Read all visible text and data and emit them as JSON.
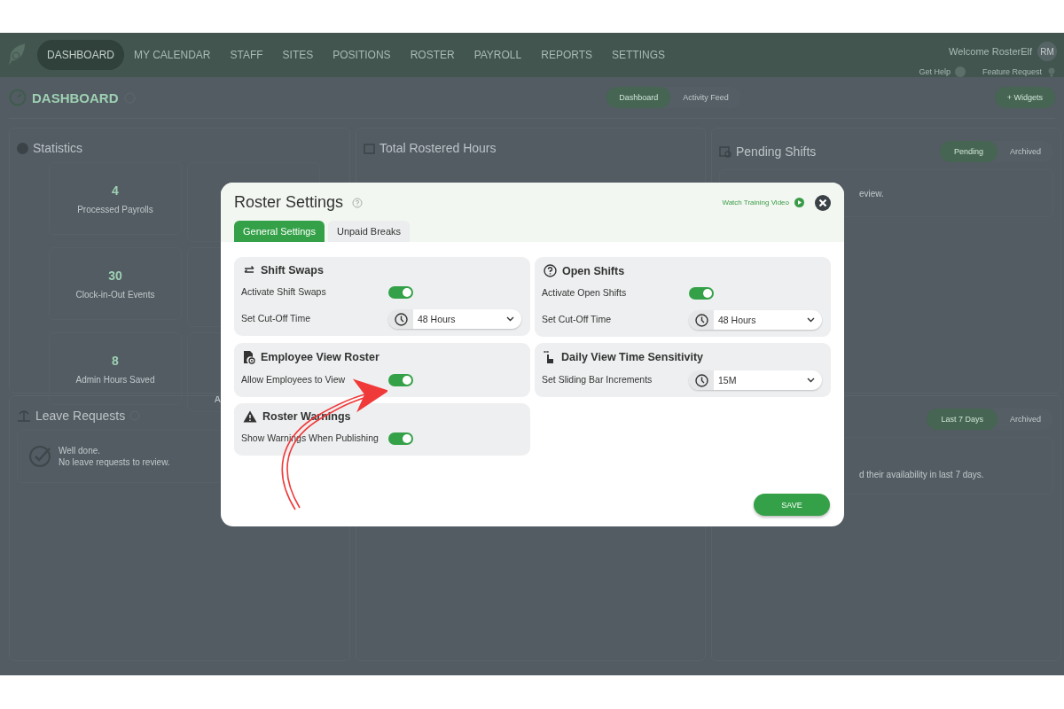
{
  "nav": {
    "items": [
      {
        "label": "DASHBOARD",
        "selected": true
      },
      {
        "label": "MY CALENDAR",
        "selected": false
      },
      {
        "label": "STAFF",
        "selected": false
      },
      {
        "label": "SITES",
        "selected": false
      },
      {
        "label": "POSITIONS",
        "selected": false
      },
      {
        "label": "ROSTER",
        "selected": false
      },
      {
        "label": "PAYROLL",
        "selected": false
      },
      {
        "label": "REPORTS",
        "selected": false
      },
      {
        "label": "SETTINGS",
        "selected": false
      }
    ],
    "welcome": "Welcome RosterElf",
    "avatar": "RM",
    "help": "Get Help",
    "feature": "Feature Request"
  },
  "page": {
    "title": "DASHBOARD",
    "views": [
      {
        "label": "Dashboard",
        "selected": true
      },
      {
        "label": "Activity Feed",
        "selected": false
      }
    ],
    "add_button": "+ Widgets"
  },
  "widgets": {
    "statistics": {
      "title": "Statistics",
      "stats": [
        {
          "value": "4",
          "label": "Processed Payrolls"
        },
        {
          "value": "30",
          "label": "Clock-in-Out Events"
        },
        {
          "value": "8",
          "label": "Admin Hours Saved"
        }
      ],
      "column_2_fragment": "A"
    },
    "total_hours": {
      "title": "Total Rostered Hours"
    },
    "pending": {
      "title": "Pending Shifts",
      "filters": [
        {
          "label": "Pending",
          "selected": true
        },
        {
          "label": "Archived",
          "selected": false
        }
      ],
      "text_fragment": "eview."
    },
    "leave": {
      "title": "Leave Requests",
      "message_1": "Well done.",
      "message_2": "No leave requests to review."
    },
    "availability": {
      "filters": [
        {
          "label": "Last 7 Days",
          "selected": true
        },
        {
          "label": "Archived",
          "selected": false
        }
      ],
      "text_fragment": "d their availability in last 7 days."
    }
  },
  "modal": {
    "title": "Roster Settings",
    "video_link": "Watch Training Video",
    "tabs": [
      {
        "label": "General Settings",
        "selected": true
      },
      {
        "label": "Unpaid Breaks",
        "selected": false
      }
    ],
    "cards": [
      {
        "title": "Shift Swaps",
        "rows": [
          {
            "kind": "toggle",
            "label": "Activate Shift Swaps",
            "on": true
          },
          {
            "kind": "select",
            "label": "Set Cut-Off Time",
            "value": "48 Hours"
          }
        ]
      },
      {
        "title": "Open Shifts",
        "rows": [
          {
            "kind": "toggle",
            "label": "Activate Open Shifts",
            "on": true
          },
          {
            "kind": "select",
            "label": "Set Cut-Off Time",
            "value": "48 Hours"
          }
        ]
      },
      {
        "title": "Employee View Roster",
        "rows": [
          {
            "kind": "toggle",
            "label": "Allow Employees to View",
            "on": true
          }
        ]
      },
      {
        "title": "Daily View Time Sensitivity",
        "rows": [
          {
            "kind": "select",
            "label": "Set Sliding Bar Increments",
            "value": "15M"
          }
        ]
      },
      {
        "title": "Roster Warnings",
        "rows": [
          {
            "kind": "toggle",
            "label": "Show Warnings When Publishing",
            "on": true
          }
        ]
      }
    ],
    "save_button": "SAVE"
  }
}
